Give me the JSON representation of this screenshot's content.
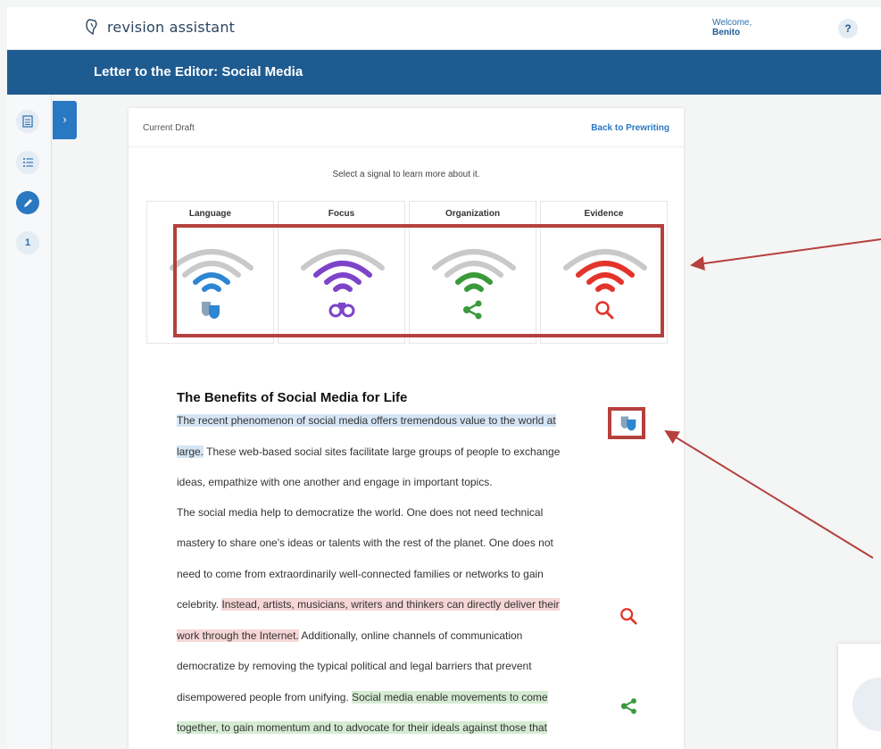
{
  "header": {
    "logo_text": "revision assistant",
    "welcome_label": "Welcome,",
    "user_name": "Benito",
    "help_label": "?"
  },
  "assignment": {
    "title": "Letter to the Editor: Social Media"
  },
  "rail": {
    "items": [
      {
        "icon": "document-icon"
      },
      {
        "icon": "list-icon"
      },
      {
        "icon": "pencil-icon"
      },
      {
        "label": "1"
      }
    ],
    "expander_label": "›"
  },
  "card": {
    "draft_label": "Current Draft",
    "back_label": "Back to Prewriting",
    "hint": "Select a signal to learn more about it."
  },
  "signals": [
    {
      "name": "Language",
      "color": "#2d86d2",
      "icon": "mask-icon",
      "strength": 2
    },
    {
      "name": "Focus",
      "color": "#7d44c9",
      "icon": "binoculars-icon",
      "strength": 3
    },
    {
      "name": "Organization",
      "color": "#3a9a3a",
      "icon": "share-icon",
      "strength": 2
    },
    {
      "name": "Evidence",
      "color": "#e3342b",
      "icon": "magnifier-icon",
      "strength": 3
    }
  ],
  "essay": {
    "title": "The Benefits of Social Media for Life",
    "para1": {
      "l1": "The recent phenomenon of social media offers tremendous value to the world at",
      "l2a": "large.",
      "l2b": " These web-based social sites facilitate large groups of people to exchange",
      "l3": "ideas, empathize with one another and engage in important topics."
    },
    "para2": {
      "l1": "The social media help to democratize the world. One does not need technical",
      "l2": "mastery to share one's ideas or talents with the rest of the planet. One does not",
      "l3": "need to come from extraordinarily well-connected families or networks to gain",
      "l4a": "celebrity. ",
      "l4b": "Instead, artists, musicians, writers and thinkers can directly deliver their",
      "l5a": "work through the Internet.",
      "l5b": " Additionally, online channels of communication",
      "l6": "democratize by removing the typical political and legal barriers that prevent",
      "l7a": "disempowered people from unifying. ",
      "l7b": "Social media enable movements to come",
      "l8": "together, to gain momentum and to advocate for their ideals against those that"
    }
  }
}
